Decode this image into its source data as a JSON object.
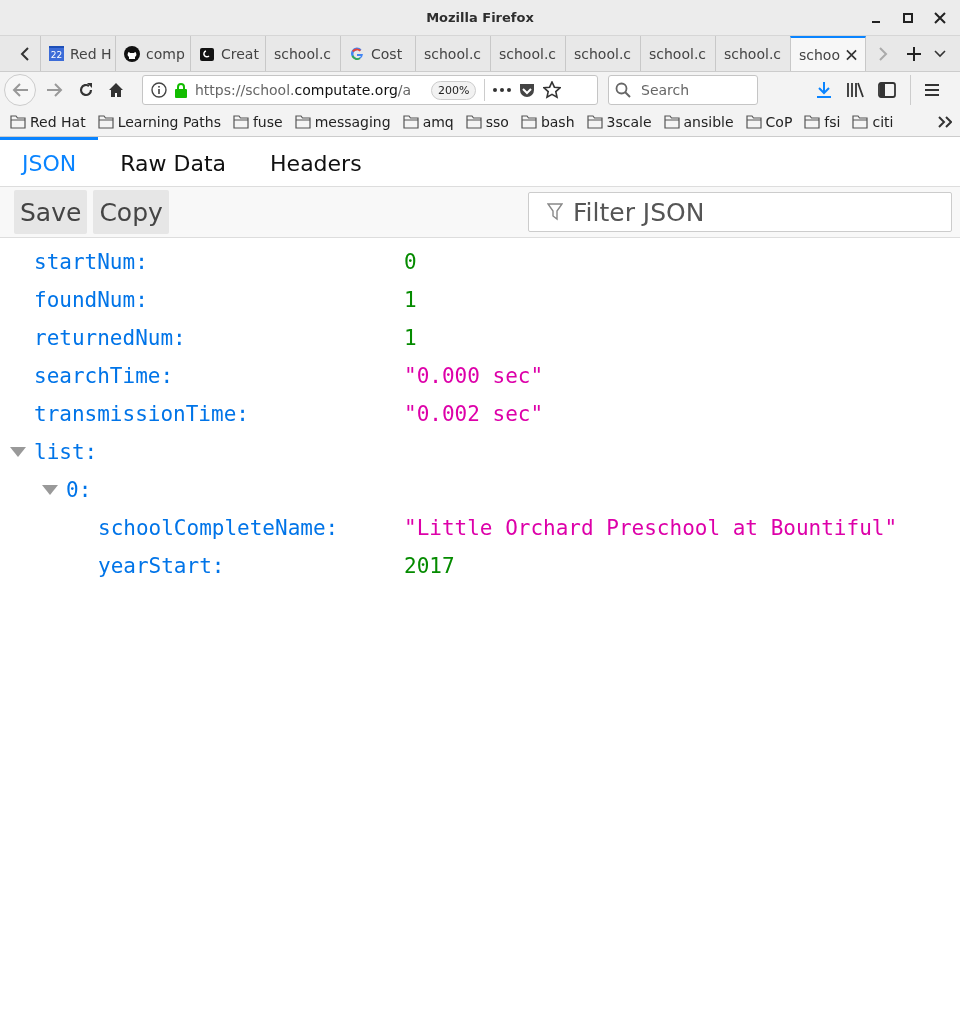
{
  "window": {
    "title": "Mozilla Firefox"
  },
  "tabs": [
    {
      "label": "Red H",
      "selected": false
    },
    {
      "label": "comp",
      "selected": false
    },
    {
      "label": "Creat",
      "selected": false
    },
    {
      "label": "school.c",
      "selected": false
    },
    {
      "label": "Cost",
      "selected": false
    },
    {
      "label": "school.c",
      "selected": false
    },
    {
      "label": "school.c",
      "selected": false
    },
    {
      "label": "school.c",
      "selected": false
    },
    {
      "label": "school.c",
      "selected": false
    },
    {
      "label": "school.c",
      "selected": false
    },
    {
      "label": "schoo",
      "selected": true
    }
  ],
  "calendar_badge": "22",
  "address_bar": {
    "url_start": "https://school.",
    "url_domain": "computate.org",
    "url_end": "/a",
    "zoom": "200%"
  },
  "search": {
    "placeholder": "Search"
  },
  "bookmarks": [
    "Red Hat",
    "Learning Paths",
    "fuse",
    "messaging",
    "amq",
    "sso",
    "bash",
    "3scale",
    "ansible",
    "CoP",
    "fsi",
    "citi"
  ],
  "viewer_tabs": [
    {
      "label": "JSON",
      "selected": true
    },
    {
      "label": "Raw Data",
      "selected": false
    },
    {
      "label": "Headers",
      "selected": false
    }
  ],
  "toolbar": {
    "buttons": [
      "Save",
      "Copy"
    ],
    "filter": {
      "placeholder": "Filter JSON"
    }
  },
  "json_tree": [
    {
      "key": "startNum:",
      "value": "0",
      "kind": "number"
    },
    {
      "key": "foundNum:",
      "value": "1",
      "kind": "number"
    },
    {
      "key": "returnedNum:",
      "value": "1",
      "kind": "number"
    },
    {
      "key": "searchTime:",
      "value": "\"0.000 sec\"",
      "kind": "string"
    },
    {
      "key": "transmissionTime:",
      "value": "\"0.002 sec\"",
      "kind": "string"
    },
    {
      "key": "list:",
      "kind": "object",
      "expanded": true,
      "children": [
        {
          "key": "0:",
          "kind": "object",
          "expanded": true,
          "children": [
            {
              "key": "schoolCompleteName:",
              "value": "\"Little Orchard Preschool at Bountiful\"",
              "kind": "string"
            },
            {
              "key": "yearStart:",
              "value": "2017",
              "kind": "number"
            }
          ]
        }
      ]
    }
  ]
}
